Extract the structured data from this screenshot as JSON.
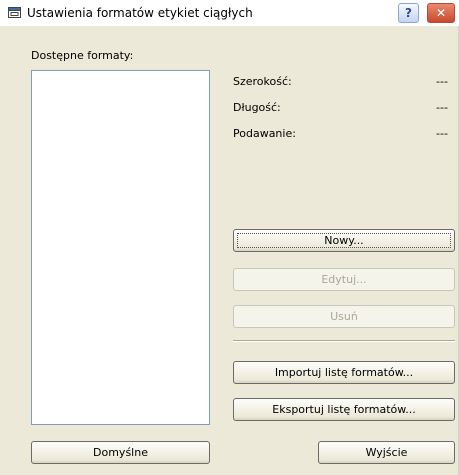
{
  "window": {
    "title": "Ustawienia formatów etykiet ciągłych",
    "help_label": "?",
    "close_label": "✕"
  },
  "list": {
    "label": "Dostępne formaty:",
    "items": []
  },
  "details": {
    "width_label": "Szerokość:",
    "width_value": "---",
    "length_label": "Długość:",
    "length_value": "---",
    "feed_label": "Podawanie:",
    "feed_value": "---"
  },
  "buttons": {
    "new": "Nowy...",
    "edit": "Edytuj...",
    "delete": "Usuń",
    "import": "Importuj listę formatów...",
    "export": "Eksportuj listę formatów...",
    "defaults": "Domyślne",
    "exit": "Wyjście"
  }
}
